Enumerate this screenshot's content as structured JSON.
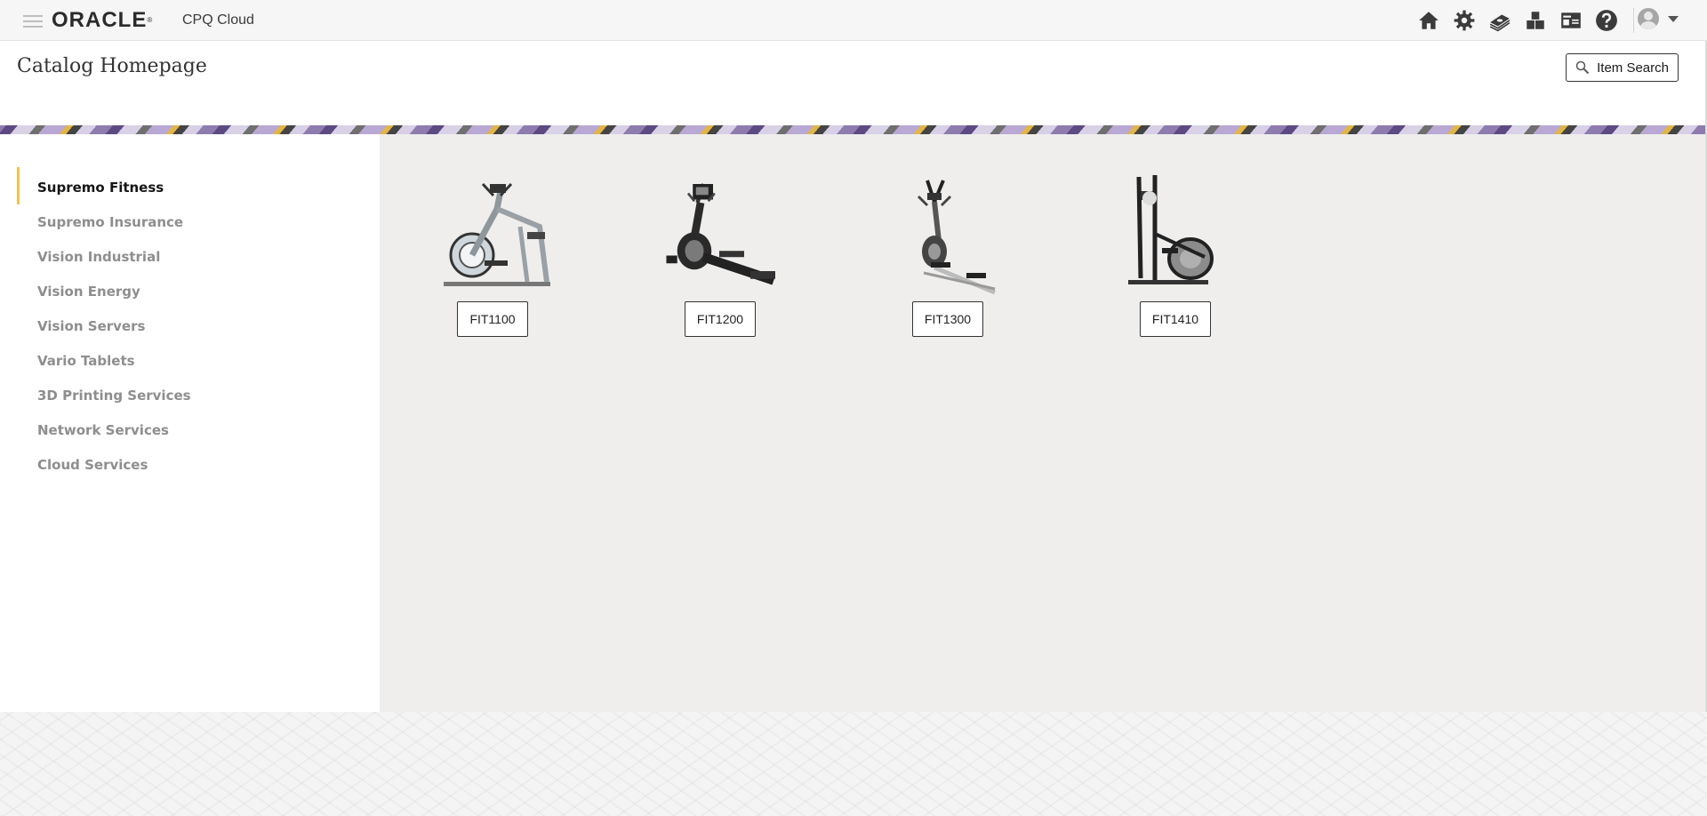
{
  "topbar": {
    "brand": "ORACLE",
    "brand_mark": "®",
    "product": "CPQ Cloud",
    "icons": [
      "home-icon",
      "gear-icon",
      "money-icon",
      "blocks-icon",
      "id-card-icon",
      "help-icon"
    ]
  },
  "header": {
    "title": "Catalog Homepage",
    "item_search_label": "Item Search"
  },
  "sidebar": {
    "items": [
      {
        "label": "Supremo Fitness",
        "active": true
      },
      {
        "label": "Supremo Insurance",
        "active": false
      },
      {
        "label": "Vision Industrial",
        "active": false
      },
      {
        "label": "Vision Energy",
        "active": false
      },
      {
        "label": "Vision Servers",
        "active": false
      },
      {
        "label": "Vario Tablets",
        "active": false
      },
      {
        "label": "3D Printing Services",
        "active": false
      },
      {
        "label": "Network Services",
        "active": false
      },
      {
        "label": "Cloud Services",
        "active": false
      }
    ]
  },
  "products": [
    {
      "label": "FIT1100"
    },
    {
      "label": "FIT1200"
    },
    {
      "label": "FIT1300"
    },
    {
      "label": "FIT1410"
    }
  ],
  "colors": {
    "active_indicator": "#f2c14e",
    "main_bg": "#efeeed",
    "topbar_bg": "#f6f6f6"
  }
}
